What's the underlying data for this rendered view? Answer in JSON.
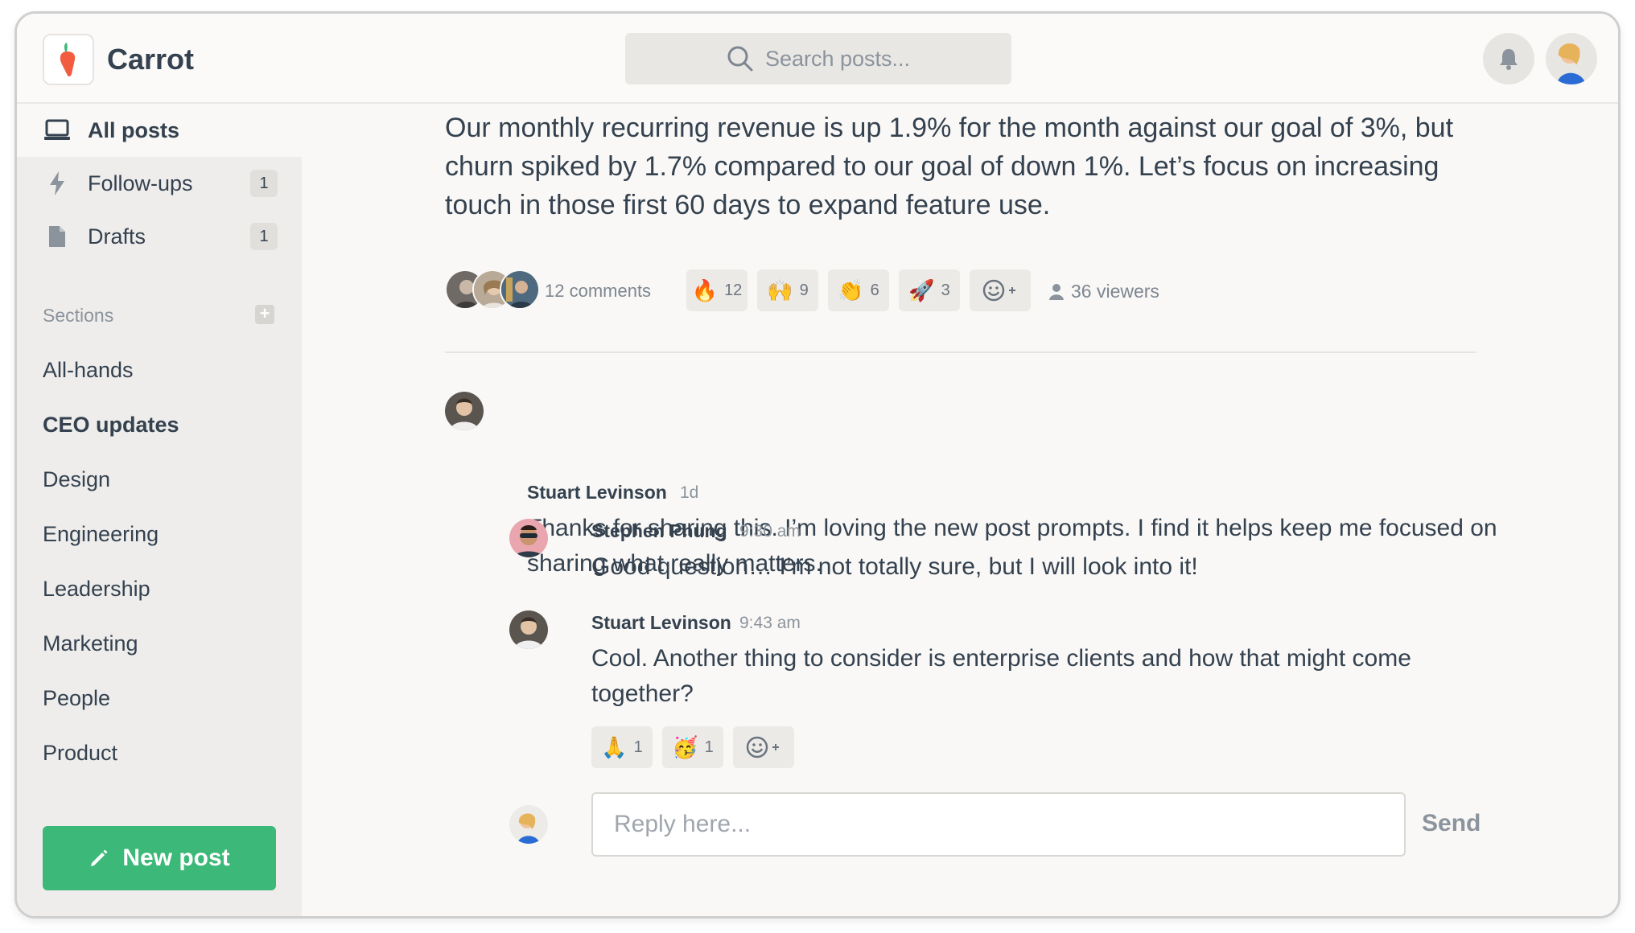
{
  "app": {
    "name": "Carrot"
  },
  "search": {
    "placeholder": "Search posts..."
  },
  "sidebar": {
    "nav": [
      {
        "label": "All posts",
        "icon": "laptop-icon",
        "count": ""
      },
      {
        "label": "Follow-ups",
        "icon": "bolt-icon",
        "count": "1"
      },
      {
        "label": "Drafts",
        "icon": "document-icon",
        "count": "1"
      }
    ],
    "sections_title": "Sections",
    "sections": [
      "All-hands",
      "CEO updates",
      "Design",
      "Engineering",
      "Leadership",
      "Marketing",
      "People",
      "Product"
    ],
    "new_post_label": "New post"
  },
  "post": {
    "text": "Our monthly recurring revenue is up 1.9% for the month against our goal of 3%, but churn spiked by 1.7% compared to our goal of down 1%. Let’s focus on increasing touch in those first 60 days to expand feature use.",
    "comments_label": "12 comments",
    "reactions": [
      {
        "emoji": "🔥",
        "count": "12"
      },
      {
        "emoji": "🙌",
        "count": "9"
      },
      {
        "emoji": "👏",
        "count": "6"
      },
      {
        "emoji": "🚀",
        "count": "3"
      }
    ],
    "viewers_label": "36 viewers"
  },
  "comments": [
    {
      "author": "Stuart Levinson",
      "time": "1d",
      "text": "Thanks for sharing this. I’m loving the new post prompts. I find it helps keep me focused on sharing what really matters."
    },
    {
      "author": "Stephen Phung",
      "time": "9:30 am",
      "text": "Good question… I’m not totally sure, but I will look into it!"
    },
    {
      "author": "Stuart Levinson",
      "time": "9:43 am",
      "text": "Cool. Another thing to consider is enterprise clients and how that might come together?",
      "reactions": [
        {
          "emoji": "🙏",
          "count": "1"
        },
        {
          "emoji": "🥳",
          "count": "1"
        }
      ]
    }
  ],
  "reply": {
    "placeholder": "Reply here...",
    "send_label": "Send"
  },
  "colors": {
    "accent_green": "#3cb878",
    "text": "#34414f",
    "muted": "#8b939c"
  }
}
